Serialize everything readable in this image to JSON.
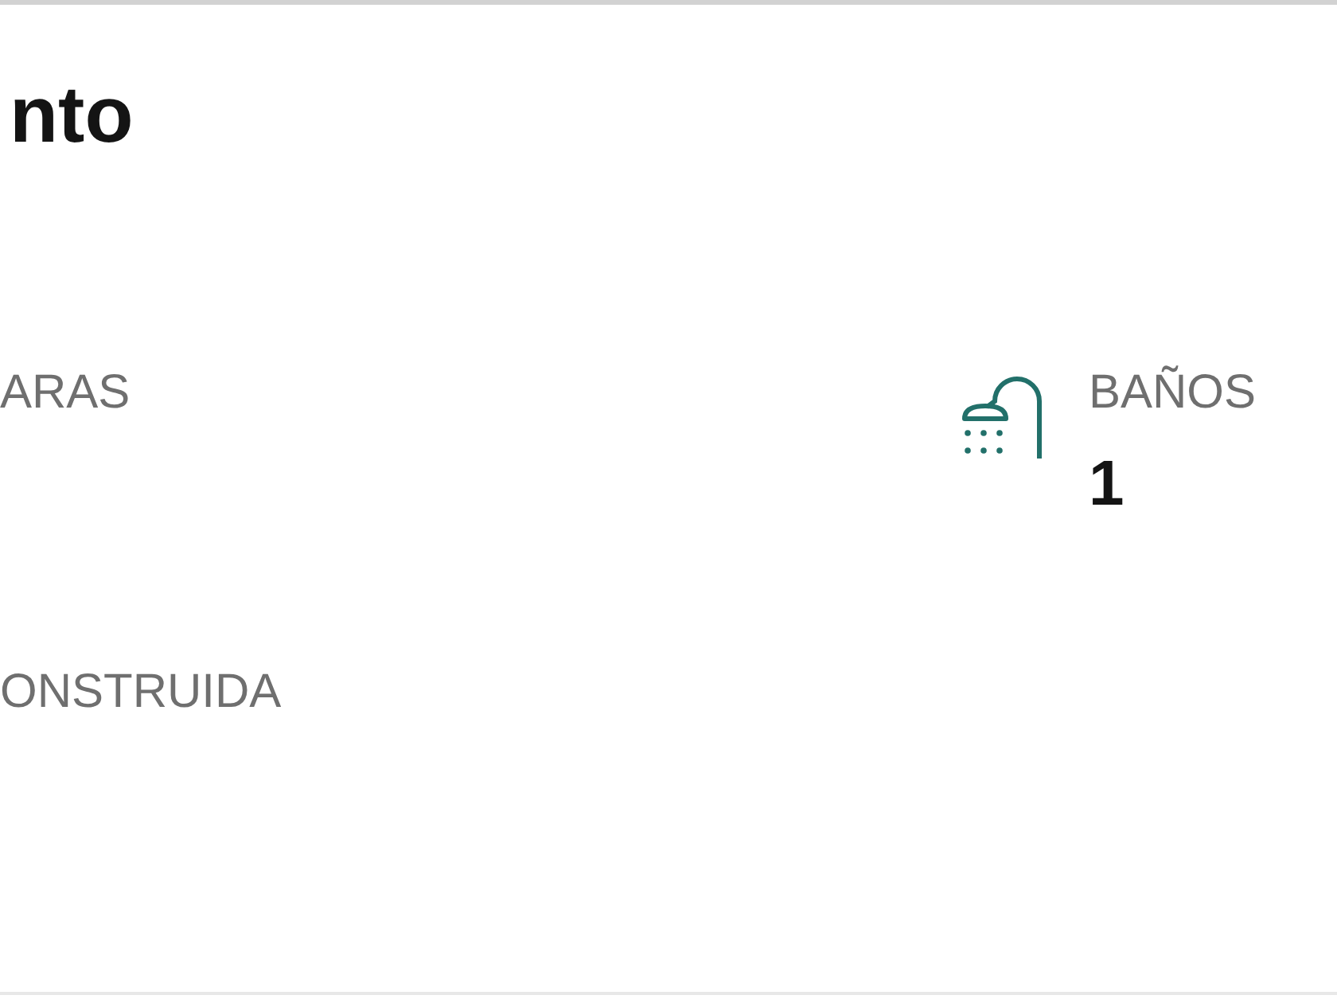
{
  "title": "nto",
  "features": [
    {
      "kind": "plain",
      "label": "ARAS"
    },
    {
      "kind": "shower",
      "label": "BAÑOS",
      "value": "1"
    },
    {
      "kind": "plain",
      "label": "ONSTRUIDA"
    }
  ]
}
